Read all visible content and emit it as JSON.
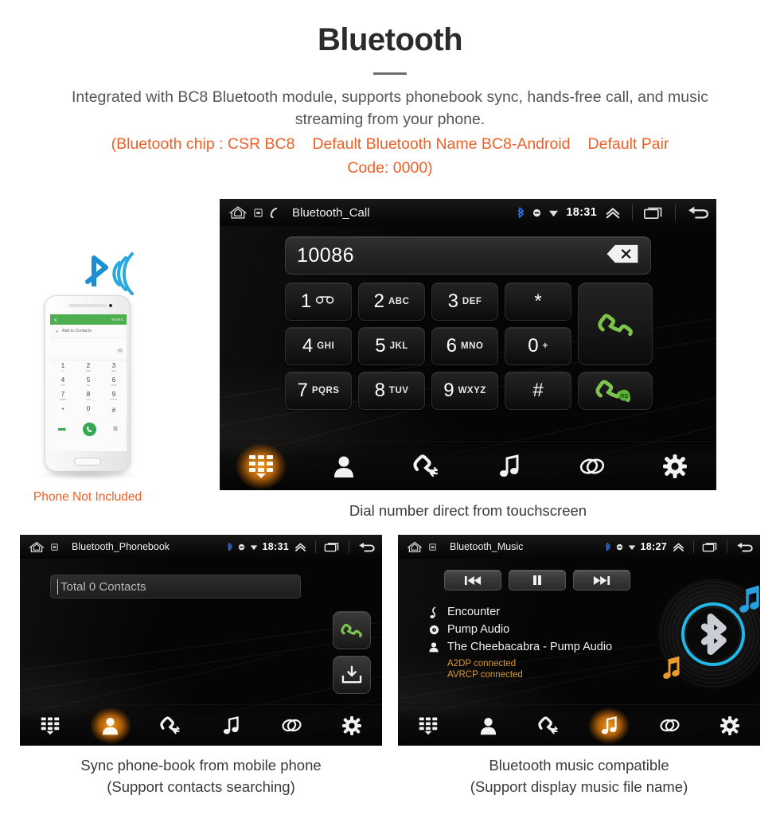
{
  "header": {
    "title": "Bluetooth",
    "subtitle": "Integrated with BC8 Bluetooth module, supports phonebook sync, hands-free call, and music streaming from your phone.",
    "spec_line1_a": "(Bluetooth chip : CSR BC8",
    "spec_line1_b": "Default Bluetooth Name BC8-Android",
    "spec_line1_c": "Default Pair",
    "spec_line2": "Code: 0000)",
    "accent_color": "#ef5f28",
    "text_color": "#555555"
  },
  "phone_mock": {
    "caption": "Phone Not Included",
    "more_label": "MORE",
    "add_contacts_label": "Add to Contacts",
    "keys": [
      {
        "digit": "1",
        "letters": "oo"
      },
      {
        "digit": "2",
        "letters": "ABC"
      },
      {
        "digit": "3",
        "letters": "DEF"
      },
      {
        "digit": "4",
        "letters": "GHI"
      },
      {
        "digit": "5",
        "letters": "JKL"
      },
      {
        "digit": "6",
        "letters": "MNO"
      },
      {
        "digit": "7",
        "letters": "PQRS"
      },
      {
        "digit": "8",
        "letters": "TUV"
      },
      {
        "digit": "9",
        "letters": "WXYZ"
      },
      {
        "digit": "*",
        "letters": ""
      },
      {
        "digit": "0",
        "letters": "+"
      },
      {
        "digit": "#",
        "letters": ""
      }
    ]
  },
  "call_screen": {
    "statusbar": {
      "title": "Bluetooth_Call",
      "time": "18:31",
      "icons": [
        "home-icon",
        "app-square-icon",
        "handset-icon",
        "bluetooth-icon",
        "circle-minus-icon",
        "wifi-icon",
        "chevron-up-icon",
        "recents-icon",
        "back-icon"
      ]
    },
    "dial_value": "10086",
    "backspace_icon": "backspace-icon",
    "keypad": [
      {
        "digit": "1",
        "letters": "",
        "icon": "voicemail-icon"
      },
      {
        "digit": "2",
        "letters": "ABC",
        "icon": ""
      },
      {
        "digit": "3",
        "letters": "DEF",
        "icon": ""
      },
      {
        "digit": "*",
        "letters": "",
        "icon": ""
      },
      {
        "digit": "4",
        "letters": "GHI",
        "icon": ""
      },
      {
        "digit": "5",
        "letters": "JKL",
        "icon": ""
      },
      {
        "digit": "6",
        "letters": "MNO",
        "icon": ""
      },
      {
        "digit": "0",
        "letters": "+",
        "icon": ""
      },
      {
        "digit": "7",
        "letters": "PQRS",
        "icon": ""
      },
      {
        "digit": "8",
        "letters": "TUV",
        "icon": ""
      },
      {
        "digit": "9",
        "letters": "WXYZ",
        "icon": ""
      },
      {
        "digit": "#",
        "letters": "",
        "icon": ""
      }
    ],
    "call_button_icon": "green-handset-icon",
    "redial_button_icon": "green-handset-redial-icon",
    "toolbar": [
      {
        "name": "dialpad",
        "icon": "dialpad-icon",
        "active": true
      },
      {
        "name": "contacts",
        "icon": "contact-icon",
        "active": false
      },
      {
        "name": "call-history",
        "icon": "call-history-icon",
        "active": false
      },
      {
        "name": "music",
        "icon": "music-note-icon",
        "active": false
      },
      {
        "name": "link",
        "icon": "link-icon",
        "active": false
      },
      {
        "name": "settings",
        "icon": "gear-icon",
        "active": false
      }
    ],
    "caption": "Dial number direct from touchscreen"
  },
  "phonebook_screen": {
    "statusbar": {
      "title": "Bluetooth_Phonebook",
      "time": "18:31"
    },
    "search_placeholder": "Total 0 Contacts",
    "call_button_icon": "green-handset-icon",
    "sync_button_icon": "download-sync-icon",
    "toolbar": [
      {
        "name": "dialpad",
        "icon": "dialpad-icon",
        "active": false
      },
      {
        "name": "contacts",
        "icon": "contact-icon",
        "active": true
      },
      {
        "name": "call-history",
        "icon": "call-history-icon",
        "active": false
      },
      {
        "name": "music",
        "icon": "music-note-icon",
        "active": false
      },
      {
        "name": "link",
        "icon": "link-icon",
        "active": false
      },
      {
        "name": "settings",
        "icon": "gear-icon",
        "active": false
      }
    ],
    "caption_line1": "Sync phone-book from mobile phone",
    "caption_line2": "(Support contacts searching)"
  },
  "music_screen": {
    "statusbar": {
      "title": "Bluetooth_Music",
      "time": "18:27"
    },
    "transport": [
      {
        "name": "previous",
        "icon": "skip-previous-icon"
      },
      {
        "name": "pause",
        "icon": "pause-icon"
      },
      {
        "name": "next",
        "icon": "skip-next-icon"
      }
    ],
    "track_title": "Encounter",
    "album": "Pump Audio",
    "artist": "The Cheebacabra - Pump Audio",
    "status_a2dp": "A2DP connected",
    "status_avrcp": "AVRCP connected",
    "status_color": "#d99a2b",
    "album_art_icon": "vinyl-bluetooth-icon",
    "toolbar": [
      {
        "name": "dialpad",
        "icon": "dialpad-icon",
        "active": false
      },
      {
        "name": "contacts",
        "icon": "contact-icon",
        "active": false
      },
      {
        "name": "call-history",
        "icon": "call-history-icon",
        "active": false
      },
      {
        "name": "music",
        "icon": "music-note-icon",
        "active": true
      },
      {
        "name": "link",
        "icon": "link-icon",
        "active": false
      },
      {
        "name": "settings",
        "icon": "gear-icon",
        "active": false
      }
    ],
    "caption_line1": "Bluetooth music compatible",
    "caption_line2": "(Support display music file name)"
  }
}
